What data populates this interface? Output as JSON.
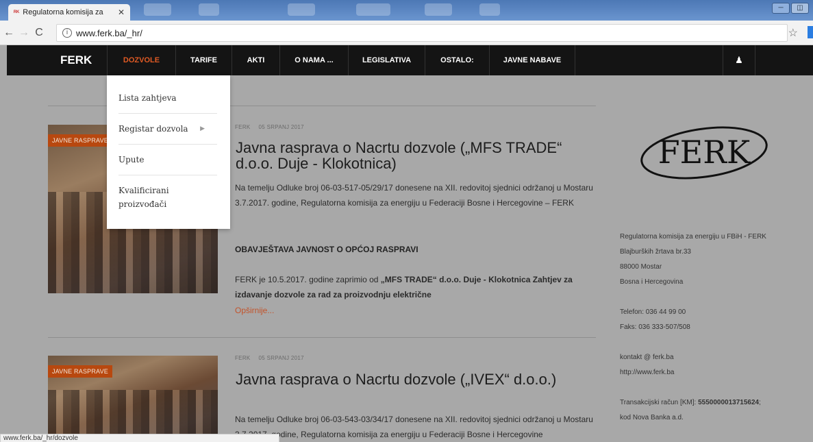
{
  "browser": {
    "tab_title": "Regulatorna komisija za",
    "tab_favicon": "ferk-favicon",
    "url": "www.ferk.ba/_hr/",
    "status_url": "www.ferk.ba/_hr/dozvole"
  },
  "nav": {
    "brand": "FERK",
    "items": [
      "DOZVOLE",
      "TARIFE",
      "AKTI",
      "O NAMA ...",
      "LEGISLATIVA",
      "OSTALO:",
      "JAVNE NABAVE"
    ],
    "active": "DOZVOLE",
    "accent_color": "#e05a24"
  },
  "dropdown": {
    "items": [
      "Lista zahtjeva",
      "Registar dozvola",
      "Upute",
      "Kvalificirani proizvođači"
    ],
    "has_submenu": "Registar dozvola"
  },
  "posts": [
    {
      "tag": "JAVNE RASPRAVE",
      "author": "FERK",
      "date": "05 SRPANJ 2017",
      "title": "Javna rasprava o Nacrtu dozvole („MFS TRADE“ d.o.o. Duje - Klokotnica)",
      "intro": "Na temelju Odluke broj 06-03-517-05/29/17 donesene na XII. redovitoj sjednici održanoj u Mostaru 3.7.2017. godine, Regulatorna komisija za energiju u Federaciji Bosne i Hercegovine – FERK",
      "heading": "OBAVJEŠTAVA JAVNOST O OPĆOJ RASPRAVI",
      "body_prefix": "FERK je 10.5.2017. godine zaprimio od ",
      "body_bold": "„MFS TRADE“ d.o.o. Duje - Klokotnica Zahtjev za izdavanje dozvole za rad za proizvodnju električne",
      "readmore": "Opširnije..."
    },
    {
      "tag": "JAVNE RASPRAVE",
      "author": "FERK",
      "date": "05 SRPANJ 2017",
      "title": "Javna rasprava o Nacrtu dozvole („IVEX“ d.o.o.)",
      "intro": "Na temelju Odluke broj 06-03-543-03/34/17 donesene na XII. redovitoj sjednici održanoj u Mostaru 3.7.2017. godine, Regulatorna komisija za energiju u Federaciji Bosne i Hercegovine"
    }
  ],
  "sidebar": {
    "logo_text": "FERK",
    "org": "Regulatorna komisija za energiju u FBiH - FERK",
    "street": "Blajburških žrtava br.33",
    "city": "88000 Mostar",
    "country": "Bosna i Hercegovina",
    "phone": "Telefon: 036 44 99 00",
    "fax": "Faks: 036 333-507/508",
    "email": "kontakt @ ferk.ba",
    "web": "http://www.ferk.ba",
    "account_label": "Transakcijski račun [KM]: ",
    "account_number": "5550000013715624",
    "bank": "kod Nova Banka a.d."
  }
}
